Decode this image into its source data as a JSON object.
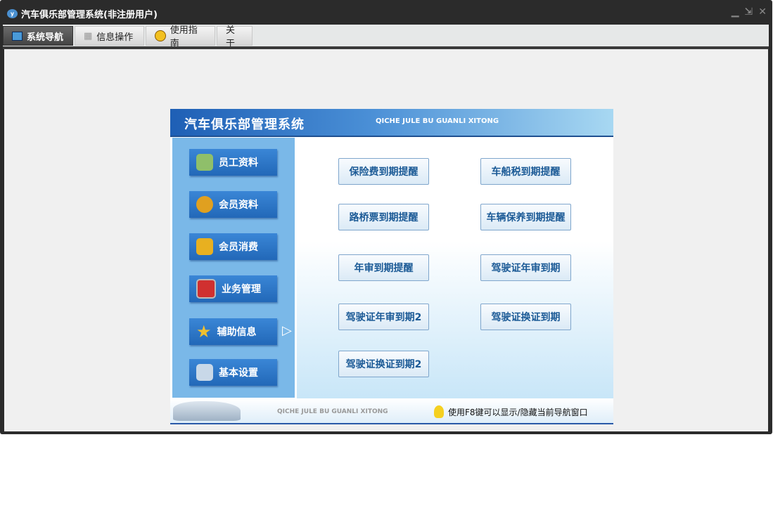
{
  "window": {
    "title": "汽车俱乐部管理系统(非注册用户)",
    "controls": [
      "minimize",
      "restore",
      "close"
    ]
  },
  "tabs": [
    {
      "label": "系统导航",
      "icon": "monitor-icon"
    },
    {
      "label": "信息操作",
      "icon": "grid-icon"
    },
    {
      "label": "使用指南",
      "icon": "help-icon"
    },
    {
      "label": "关于"
    }
  ],
  "panel": {
    "title": "汽车俱乐部管理系统",
    "subtitle": "QICHE JULE BU GUANLI XITONG"
  },
  "sidebar": [
    {
      "label": "员工资料",
      "icon": "employee-card-icon",
      "color": "#8fbf6a"
    },
    {
      "label": "会员资料",
      "icon": "members-icon",
      "color": "#e0a020"
    },
    {
      "label": "会员消费",
      "icon": "coins-icon",
      "color": "#e8b020"
    },
    {
      "label": "业务管理",
      "icon": "monitor-icon",
      "color": "#d03030"
    },
    {
      "label": "辅助信息",
      "icon": "star-icon",
      "color": "#f0c030"
    },
    {
      "label": "基本设置",
      "icon": "settings-doc-icon",
      "color": "#c8d8e8"
    }
  ],
  "buttons": [
    "保险费到期提醒",
    "车船税到期提醒",
    "路桥票到期提醒",
    "车辆保养到期提醒",
    "年审到期提醒",
    "驾驶证年审到期",
    "驾驶证年审到期2",
    "驾驶证换证到期",
    "驾驶证换证到期2"
  ],
  "footer": {
    "subtitle": "QICHE JULE BU GUANLI XITONG",
    "tip": "使用F8键可以显示/隐藏当前导航窗口"
  }
}
